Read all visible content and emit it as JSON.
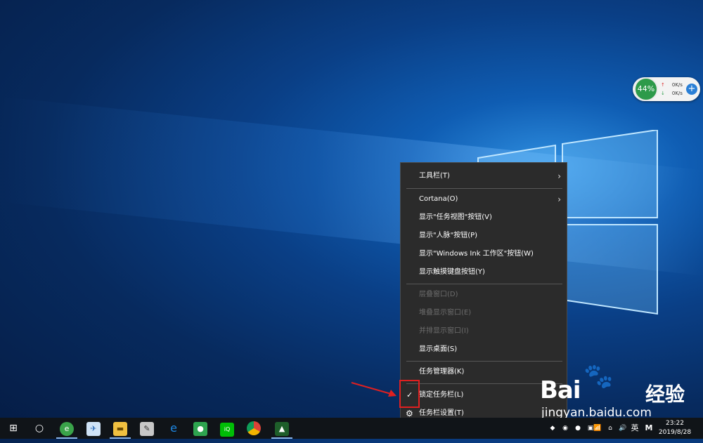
{
  "desktop": {
    "speed_widget": {
      "percent": "44%",
      "upload": "0K/s",
      "download": "0K/s",
      "accent": "#2d9a4a"
    }
  },
  "context_menu": {
    "items": [
      {
        "label": "工具栏(T)",
        "submenu": true,
        "enabled": true
      },
      {
        "label": "Cortana(O)",
        "submenu": true,
        "enabled": true
      },
      {
        "label": "显示\"任务视图\"按钮(V)",
        "enabled": true
      },
      {
        "label": "显示\"人脉\"按钮(P)",
        "enabled": true
      },
      {
        "label": "显示\"Windows Ink 工作区\"按钮(W)",
        "enabled": true
      },
      {
        "label": "显示触摸键盘按钮(Y)",
        "enabled": true
      },
      {
        "label": "层叠窗口(D)",
        "enabled": false
      },
      {
        "label": "堆叠显示窗口(E)",
        "enabled": false
      },
      {
        "label": "并排显示窗口(I)",
        "enabled": false
      },
      {
        "label": "显示桌面(S)",
        "enabled": true
      },
      {
        "label": "任务管理器(K)",
        "enabled": true
      },
      {
        "label": "锁定任务栏(L)",
        "enabled": true,
        "checked": true
      },
      {
        "label": "任务栏设置(T)",
        "enabled": true,
        "icon": "gear-icon"
      }
    ],
    "highlight_color": "#e02020"
  },
  "watermark": {
    "brand": "Bai",
    "brand_cn": "经验",
    "url": "jingyan.baidu.com"
  },
  "taskbar": {
    "apps": [
      "windows-start-icon",
      "cortana-search-icon",
      "browser-icon",
      "feather-app-icon",
      "file-explorer-icon",
      "paint-icon",
      "internet-explorer-icon",
      "wechat-icon",
      "iqiyi-icon",
      "chrome-icon",
      "game-icon"
    ],
    "tray": {
      "ime": "英",
      "ime_mode": "M"
    },
    "clock": {
      "time": "23:22",
      "date": "2019/8/28"
    }
  }
}
